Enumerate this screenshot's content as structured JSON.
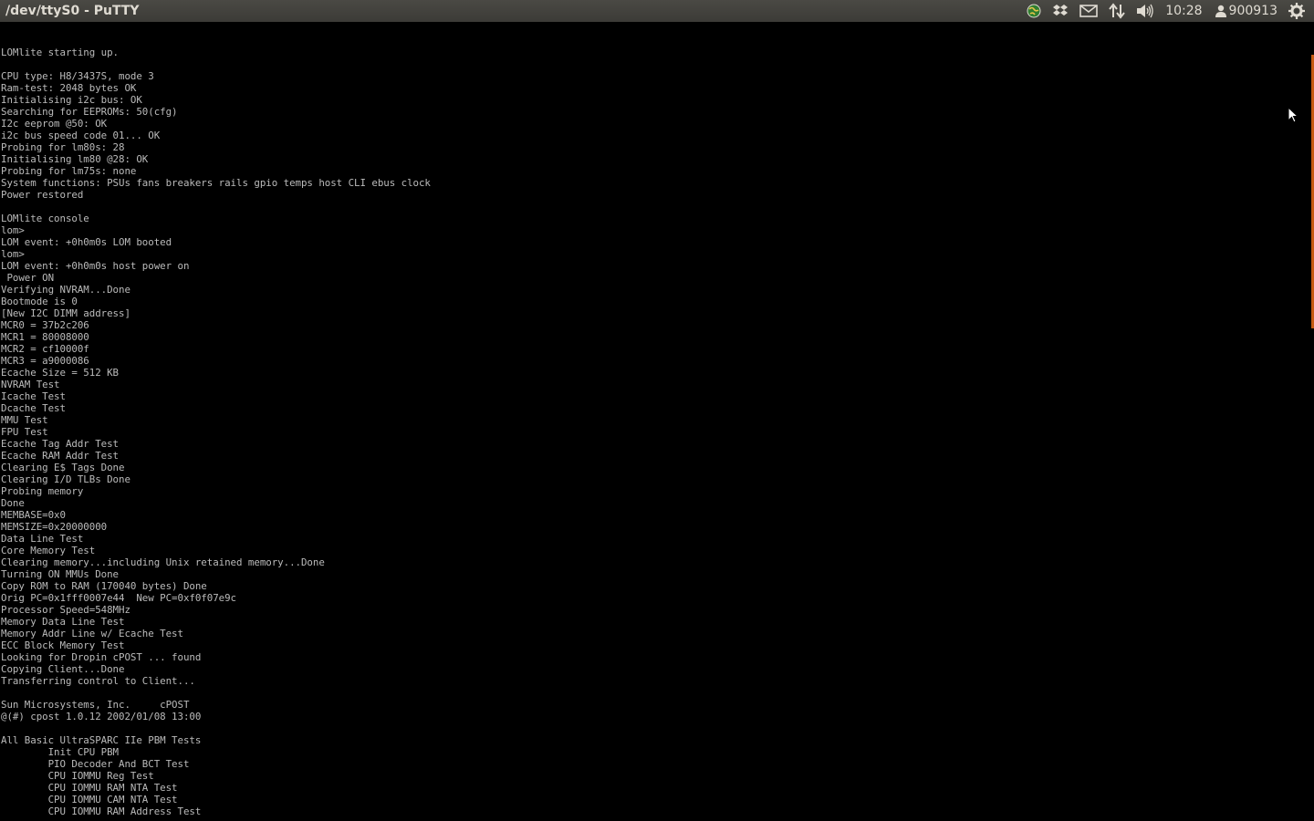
{
  "window": {
    "title": "/dev/ttyS0 - PuTTY"
  },
  "panel": {
    "indicators": [
      {
        "icon": "network-globe-icon"
      },
      {
        "icon": "dropbox-icon"
      },
      {
        "icon": "mail-icon"
      },
      {
        "icon": "network-transfer-icon"
      },
      {
        "icon": "volume-icon"
      }
    ],
    "clock": "10:28",
    "user_name": "900913",
    "session_icon": "gear-icon"
  },
  "colors": {
    "panel_bg": "#3c3b37",
    "panel_text": "#dfdbd2",
    "terminal_bg": "#000000",
    "terminal_fg": "#bbbbbb",
    "scrollbar_accent": "#c55a12"
  },
  "terminal": {
    "lines": [
      "LOMlite starting up.",
      "",
      "CPU type: H8/3437S, mode 3",
      "Ram-test: 2048 bytes OK",
      "Initialising i2c bus: OK",
      "Searching for EEPROMs: 50(cfg)",
      "I2c eeprom @50: OK",
      "i2c bus speed code 01... OK",
      "Probing for lm80s: 28",
      "Initialising lm80 @28: OK",
      "Probing for lm75s: none",
      "System functions: PSUs fans breakers rails gpio temps host CLI ebus clock",
      "Power restored",
      "",
      "LOMlite console",
      "lom>",
      "LOM event: +0h0m0s LOM booted",
      "lom>",
      "LOM event: +0h0m0s host power on",
      " Power ON",
      "Verifying NVRAM...Done",
      "Bootmode is 0",
      "[New I2C DIMM address]",
      "MCR0 = 37b2c206",
      "MCR1 = 80008000",
      "MCR2 = cf10000f",
      "MCR3 = a9000086",
      "Ecache Size = 512 KB",
      "NVRAM Test",
      "Icache Test",
      "Dcache Test",
      "MMU Test",
      "FPU Test",
      "Ecache Tag Addr Test",
      "Ecache RAM Addr Test",
      "Clearing E$ Tags Done",
      "Clearing I/D TLBs Done",
      "Probing memory",
      "Done",
      "MEMBASE=0x0",
      "MEMSIZE=0x20000000",
      "Data Line Test",
      "Core Memory Test",
      "Clearing memory...including Unix retained memory...Done",
      "Turning ON MMUs Done",
      "Copy ROM to RAM (170040 bytes) Done",
      "Orig PC=0x1fff0007e44  New PC=0xf0f07e9c",
      "Processor Speed=548MHz",
      "Memory Data Line Test",
      "Memory Addr Line w/ Ecache Test",
      "ECC Block Memory Test",
      "Looking for Dropin cPOST ... found",
      "Copying Client...Done",
      "Transferring control to Client...",
      "",
      "Sun Microsystems, Inc.     cPOST",
      "@(#) cpost 1.0.12 2002/01/08 13:00",
      "",
      "All Basic UltraSPARC IIe PBM Tests",
      "        Init CPU PBM",
      "        PIO Decoder And BCT Test",
      "        CPU IOMMU Reg Test",
      "        CPU IOMMU RAM NTA Test",
      "        CPU IOMMU CAM NTA Test",
      "        CPU IOMMU RAM Address Test"
    ]
  }
}
